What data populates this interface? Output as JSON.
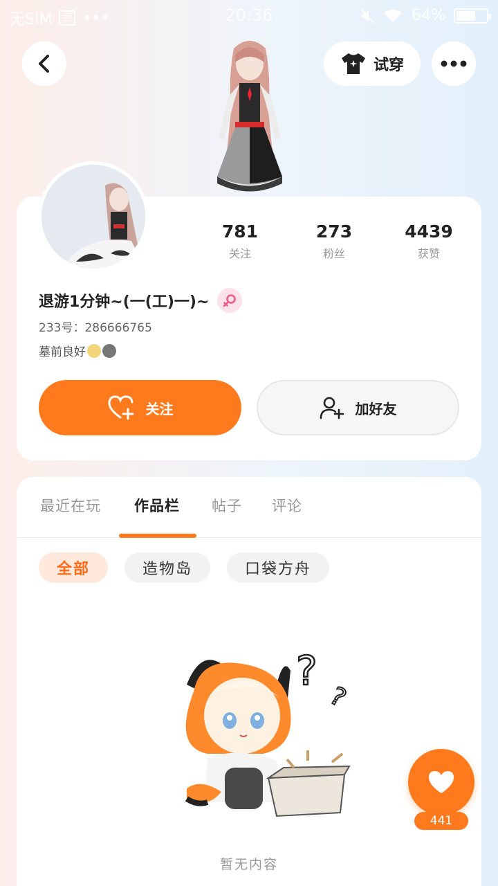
{
  "status_bar": {
    "carrier": "无SIM",
    "sim_label": "亖",
    "dots": "•••",
    "time": "20:36",
    "battery": "64%",
    "battery_level": 0.64
  },
  "header": {
    "tryon_label": "试穿"
  },
  "profile": {
    "stats": [
      {
        "value": "781",
        "label": "关注"
      },
      {
        "value": "273",
        "label": "粉丝"
      },
      {
        "value": "4439",
        "label": "获赞"
      }
    ],
    "username": "退游1分钟~(一(工)一)~",
    "uid": "233号：286666765",
    "bio": "墓前良好",
    "follow_label": "关注",
    "add_friend_label": "加好友"
  },
  "tabs": [
    {
      "label": "最近在玩",
      "active": false
    },
    {
      "label": "作品栏",
      "active": true
    },
    {
      "label": "帖子",
      "active": false
    },
    {
      "label": "评论",
      "active": false
    }
  ],
  "chips": [
    {
      "label": "全部",
      "active": true
    },
    {
      "label": "造物岛",
      "active": false
    },
    {
      "label": "口袋方舟",
      "active": false
    }
  ],
  "empty_text": "暂无内容",
  "like_count": "441",
  "colors": {
    "accent": "#ff7a1c",
    "chip_active_bg": "#ffe8dc",
    "gender_badge": "#fde2ea"
  }
}
